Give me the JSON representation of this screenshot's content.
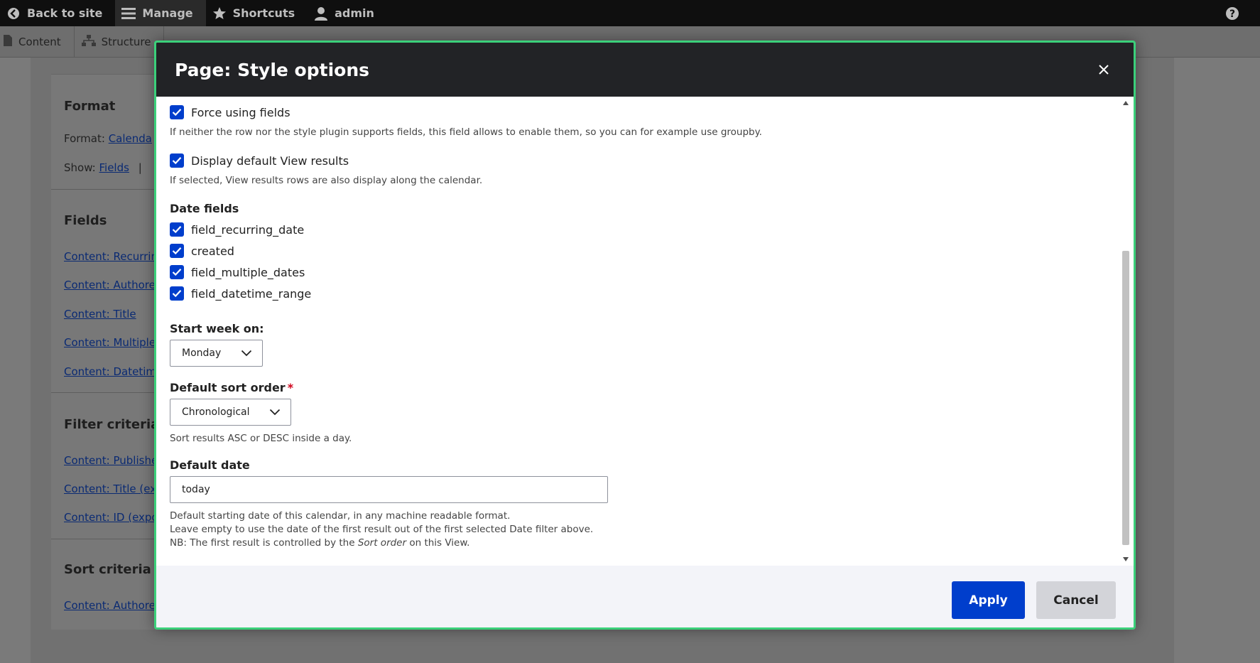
{
  "toolbar": {
    "back_label": "Back to site",
    "manage_label": "Manage",
    "shortcuts_label": "Shortcuts",
    "user_label": "admin"
  },
  "tray": {
    "content_label": "Content",
    "structure_label": "Structure"
  },
  "background": {
    "format_title": "Format",
    "format_label": "Format:",
    "format_value": "Calenda",
    "show_label": "Show:",
    "show_value": "Fields",
    "fields_title": "Fields",
    "field_links": [
      "Content: Recurrin",
      "Content: Authore",
      "Content: Title",
      "Content: Multiple",
      "Content: Datetim"
    ],
    "filter_title": "Filter criteria",
    "filter_links": [
      "Content: Publishe",
      "Content: Title (ex",
      "Content: ID (expo"
    ],
    "sort_title": "Sort criteria",
    "sort_links": [
      "Content: Authore"
    ]
  },
  "modal": {
    "title": "Page: Style options",
    "force_fields_label": "Force using fields",
    "force_fields_desc": "If neither the row nor the style plugin supports fields, this field allows to enable them, so you can for example use groupby.",
    "display_default_label": "Display default View results",
    "display_default_desc": "If selected, View results rows are also display along the calendar.",
    "date_fields_title": "Date fields",
    "date_fields": [
      "field_recurring_date",
      "created",
      "field_multiple_dates",
      "field_datetime_range"
    ],
    "start_week_label": "Start week on:",
    "start_week_value": "Monday",
    "sort_order_label": "Default sort order",
    "sort_order_required": "*",
    "sort_order_value": "Chronological",
    "sort_order_desc": "Sort results ASC or DESC inside a day.",
    "default_date_label": "Default date",
    "default_date_value": "today",
    "default_date_desc_1": "Default starting date of this calendar, in any machine readable format.",
    "default_date_desc_2": "Leave empty to use the date of the first result out of the first selected Date filter above.",
    "default_date_desc_3_pre": "NB: The first result is controlled by the ",
    "default_date_desc_3_em": "Sort order",
    "default_date_desc_3_post": " on this View.",
    "apply_label": "Apply",
    "cancel_label": "Cancel"
  },
  "colors": {
    "accent": "#003ecc",
    "modal_border": "#3bd07a",
    "header_bg": "#222326"
  }
}
